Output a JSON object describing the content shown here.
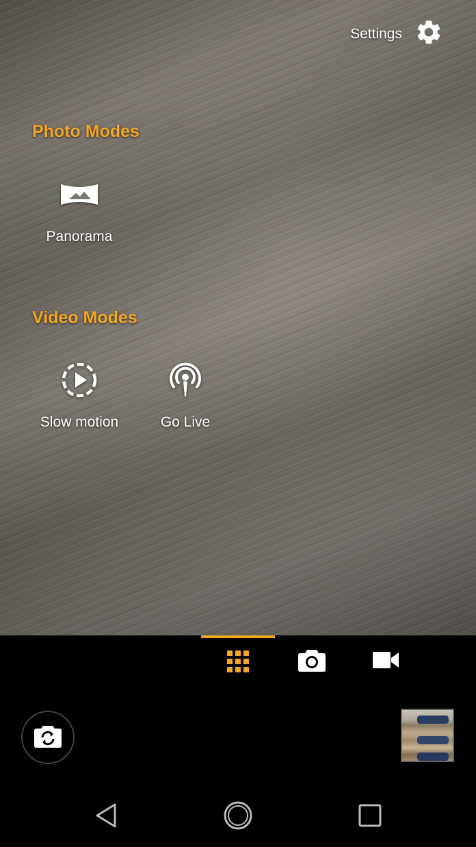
{
  "settings": {
    "label": "Settings",
    "icon": "gear-icon"
  },
  "photo_modes": {
    "title": "Photo Modes",
    "items": [
      {
        "label": "Panorama",
        "icon": "panorama-icon"
      }
    ]
  },
  "video_modes": {
    "title": "Video Modes",
    "items": [
      {
        "label": "Slow motion",
        "icon": "slow-motion-icon"
      },
      {
        "label": "Go Live",
        "icon": "live-broadcast-icon"
      }
    ]
  },
  "mode_tabs": [
    {
      "icon": "grid-icon",
      "active": true
    },
    {
      "icon": "camera-icon",
      "active": false
    },
    {
      "icon": "videocam-icon",
      "active": false
    }
  ],
  "colors": {
    "accent": "#f5a623",
    "background": "#000000",
    "text": "#ffffff"
  },
  "controls": {
    "switch_camera_icon": "switch-camera-icon",
    "gallery_thumbnail": "gallery-thumbnail"
  },
  "navigation": {
    "back_icon": "back-icon",
    "home_icon": "home-icon",
    "recents_icon": "recents-icon"
  }
}
